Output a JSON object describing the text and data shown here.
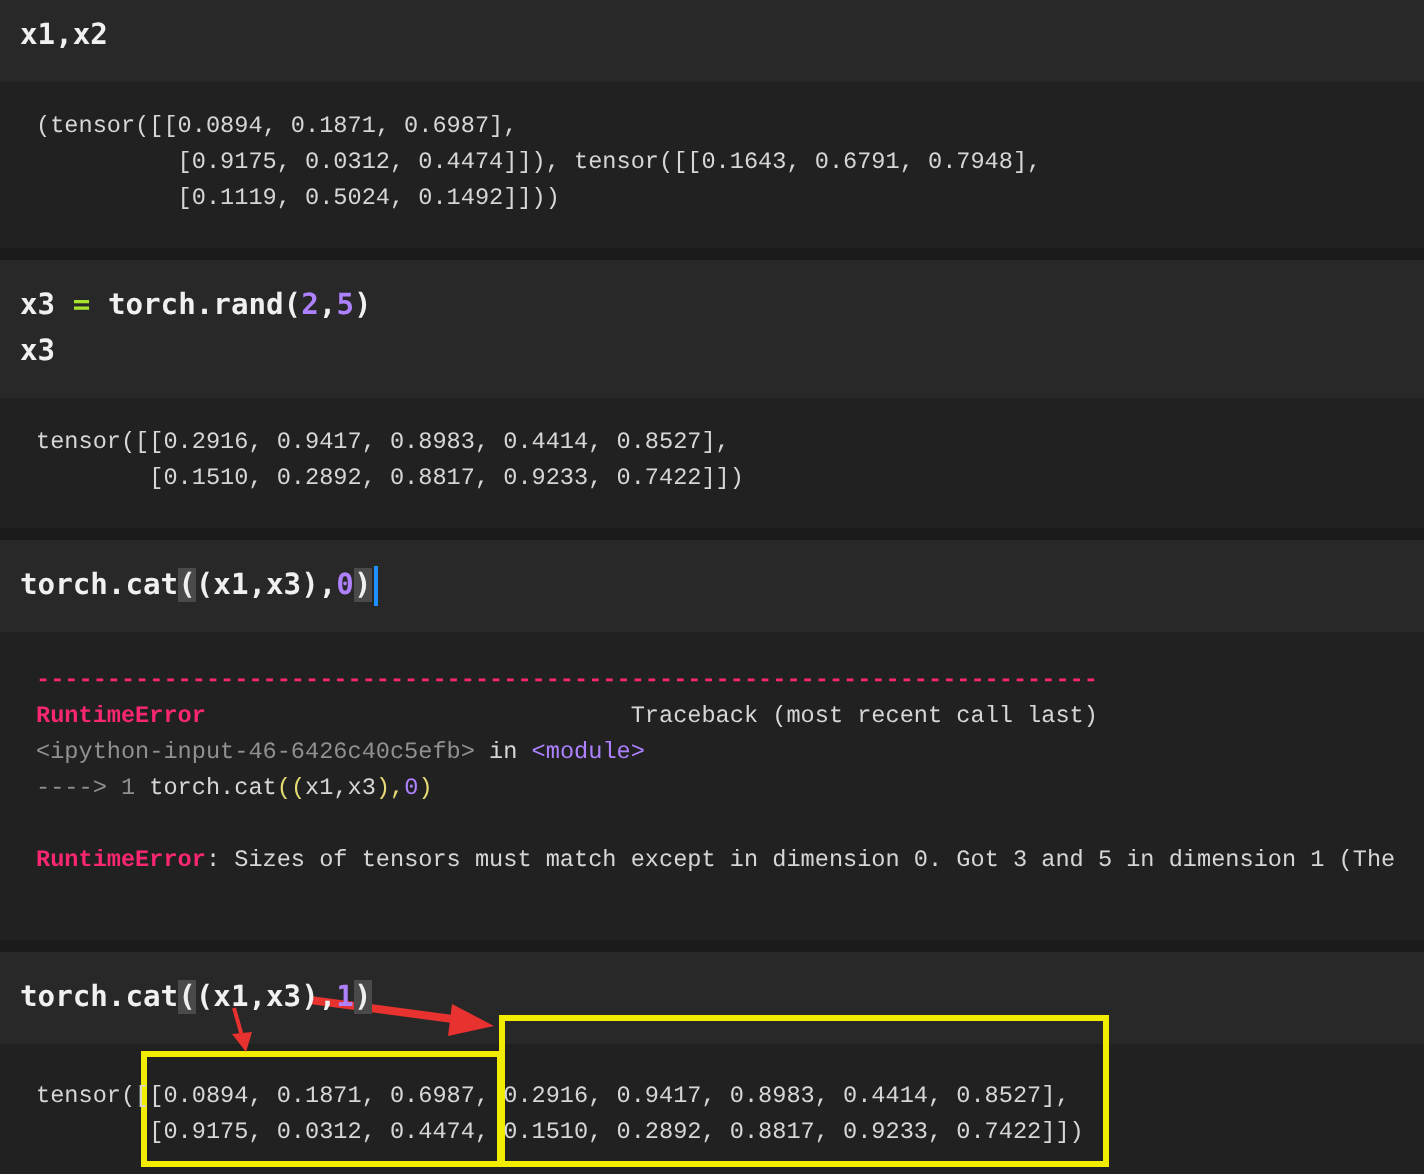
{
  "cells": [
    {
      "focused": false,
      "annotated": false,
      "input": [
        [
          {
            "kind": "plain",
            "text": "x1,x2"
          }
        ]
      ],
      "output": {
        "kind": "result",
        "blocks": [
          [
            [
              {
                "kind": "plain",
                "text": "(tensor([[0.0894, 0.1871, 0.6987],"
              }
            ],
            [
              {
                "kind": "plain",
                "text": "          [0.9175, 0.0312, 0.4474]]), tensor([[0.1643, 0.6791, 0.7948],"
              }
            ],
            [
              {
                "kind": "plain",
                "text": "          [0.1119, 0.5024, 0.1492]]))"
              }
            ]
          ]
        ]
      }
    },
    {
      "focused": false,
      "annotated": false,
      "input": [
        [
          {
            "kind": "plain",
            "text": "x3 "
          },
          {
            "kind": "op",
            "text": "="
          },
          {
            "kind": "plain",
            "text": " torch.rand("
          },
          {
            "kind": "num",
            "text": "2"
          },
          {
            "kind": "plain",
            "text": ","
          },
          {
            "kind": "num",
            "text": "5"
          },
          {
            "kind": "plain",
            "text": ")"
          }
        ],
        [
          {
            "kind": "plain",
            "text": "x3"
          }
        ]
      ],
      "output": {
        "kind": "result",
        "blocks": [
          [
            [
              {
                "kind": "plain",
                "text": "tensor([[0.2916, 0.9417, 0.8983, 0.4414, 0.8527],"
              }
            ],
            [
              {
                "kind": "plain",
                "text": "        [0.1510, 0.2892, 0.8817, 0.9233, 0.7422]])"
              }
            ]
          ]
        ]
      }
    },
    {
      "focused": true,
      "annotated": false,
      "input": [
        [
          {
            "kind": "plain",
            "text": "torch.cat"
          },
          {
            "kind": "match",
            "text": "("
          },
          {
            "kind": "plain",
            "text": "(x1,x3),"
          },
          {
            "kind": "num",
            "text": "0"
          },
          {
            "kind": "match",
            "text": ")"
          }
        ]
      ],
      "output": {
        "kind": "error",
        "blocks": [
          [
            [
              {
                "kind": "err",
                "text": "---------------------------------------------------------------------------"
              }
            ],
            [
              {
                "kind": "err",
                "text": "RuntimeError"
              },
              {
                "kind": "plain",
                "text": "                              Traceback (most recent call last)"
              }
            ],
            [
              {
                "kind": "dim",
                "text": "<ipython-input-46-6426c40c5efb>"
              },
              {
                "kind": "plain",
                "text": " in "
              },
              {
                "kind": "mod",
                "text": "<module>"
              }
            ],
            [
              {
                "kind": "dim",
                "text": "----> 1 "
              },
              {
                "kind": "plain",
                "text": "torch.cat"
              },
              {
                "kind": "paren",
                "text": "(("
              },
              {
                "kind": "plain",
                "text": "x1,x3"
              },
              {
                "kind": "paren",
                "text": "),"
              },
              {
                "kind": "num",
                "text": "0"
              },
              {
                "kind": "paren",
                "text": ")"
              }
            ]
          ],
          [
            [
              {
                "kind": "err",
                "text": "RuntimeError"
              },
              {
                "kind": "plain",
                "text": ": Sizes of tensors must match except in dimension 0. Got 3 and 5 in dimension 1 (The"
              }
            ]
          ]
        ]
      }
    },
    {
      "focused": false,
      "annotated": true,
      "input": [
        [
          {
            "kind": "plain",
            "text": "torch.cat"
          },
          {
            "kind": "match",
            "text": "("
          },
          {
            "kind": "plain",
            "text": "(x1,x3),"
          },
          {
            "kind": "num",
            "text": "1"
          },
          {
            "kind": "match",
            "text": ")"
          }
        ]
      ],
      "output": {
        "kind": "result",
        "blocks": [
          [
            [
              {
                "kind": "plain",
                "text": "tensor([[0.0894, 0.1871, 0.6987, 0.2916, 0.9417, 0.8983, 0.4414, 0.8527],"
              }
            ],
            [
              {
                "kind": "plain",
                "text": "        [0.9175, 0.0312, 0.4474, 0.1510, 0.2892, 0.8817, 0.9233, 0.7422]])"
              }
            ]
          ]
        ]
      }
    }
  ]
}
